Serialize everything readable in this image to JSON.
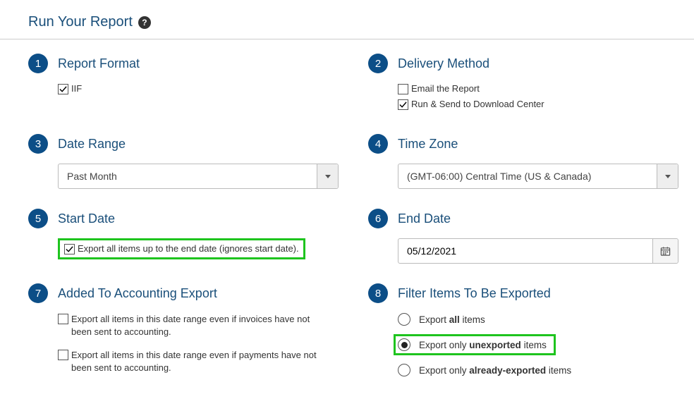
{
  "title": "Run Your Report",
  "sections": {
    "s1": {
      "num": "1",
      "title": "Report Format",
      "iif": "IIF"
    },
    "s2": {
      "num": "2",
      "title": "Delivery Method",
      "email": "Email the Report",
      "download": "Run & Send to Download Center"
    },
    "s3": {
      "num": "3",
      "title": "Date Range",
      "value": "Past Month"
    },
    "s4": {
      "num": "4",
      "title": "Time Zone",
      "value": "(GMT-06:00) Central Time (US & Canada)"
    },
    "s5": {
      "num": "5",
      "title": "Start Date",
      "opt": "Export all items up to the end date (ignores start date)."
    },
    "s6": {
      "num": "6",
      "title": "End Date",
      "value": "05/12/2021"
    },
    "s7": {
      "num": "7",
      "title": "Added To Accounting Export",
      "invoices": "Export all items in this date range even if invoices have not been sent to accounting.",
      "payments": "Export all items in this date range even if payments have not been sent to accounting."
    },
    "s8": {
      "num": "8",
      "title": "Filter Items To Be Exported",
      "r1a": "Export ",
      "r1b": "all",
      "r1c": " items",
      "r2a": "Export only ",
      "r2b": "unexported",
      "r2c": " items",
      "r3a": "Export only ",
      "r3b": "already-exported",
      "r3c": " items"
    }
  }
}
